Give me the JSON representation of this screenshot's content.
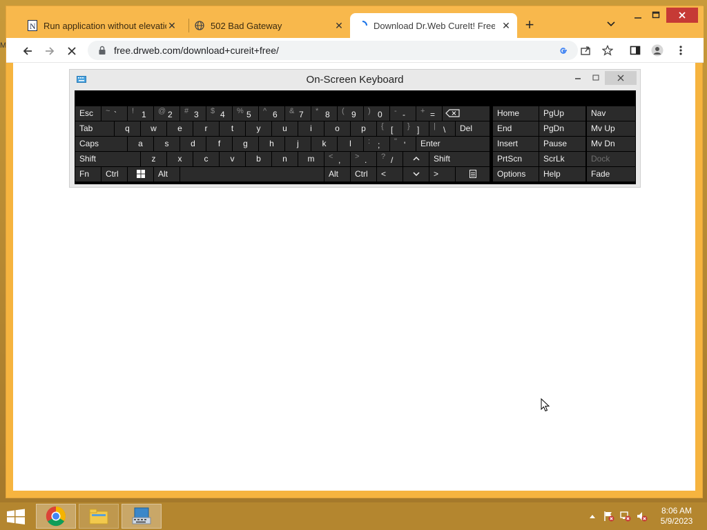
{
  "browser": {
    "tabs": [
      {
        "title": "Run application without elevation",
        "icon": "notion-icon",
        "active": false
      },
      {
        "title": "502 Bad Gateway",
        "icon": "globe-icon",
        "active": false
      },
      {
        "title": "Download Dr.Web CureIt! Free to",
        "icon": "loading-icon",
        "active": true
      }
    ],
    "url": "free.drweb.com/download+cureit+free/"
  },
  "osk": {
    "title": "On-Screen Keyboard",
    "rows": [
      [
        "Esc",
        "~`",
        "!1",
        "@2",
        "#3",
        "$4",
        "%5",
        "^6",
        "&7",
        "*8",
        "(9",
        ")0",
        "-",
        "+=",
        "Home",
        "PgUp",
        "Nav"
      ],
      [
        "Tab",
        "q",
        "w",
        "e",
        "r",
        "t",
        "y",
        "u",
        "i",
        "o",
        "p",
        "[",
        "]",
        "\\",
        "Del",
        "End",
        "PgDn",
        "Mv Up"
      ],
      [
        "Caps",
        "a",
        "s",
        "d",
        "f",
        "g",
        "h",
        "j",
        "k",
        "l",
        ";",
        "'",
        "Enter",
        "Insert",
        "Pause",
        "Mv Dn"
      ],
      [
        "Shift",
        "z",
        "x",
        "c",
        "v",
        "b",
        "n",
        "m",
        ",",
        ".",
        "/",
        "^",
        "Shift",
        "PrtScn",
        "ScrLk",
        "Dock"
      ],
      [
        "Fn",
        "Ctrl",
        "Alt",
        "Alt",
        "Ctrl",
        "<",
        "v",
        ">",
        "Options",
        "Help",
        "Fade"
      ]
    ],
    "keys": {
      "esc": "Esc",
      "tab": "Tab",
      "caps": "Caps",
      "shift": "Shift",
      "fn": "Fn",
      "ctrl": "Ctrl",
      "alt": "Alt",
      "del": "Del",
      "enter": "Enter",
      "home": "Home",
      "pgup": "PgUp",
      "nav": "Nav",
      "end": "End",
      "pgdn": "PgDn",
      "mvup": "Mv Up",
      "insert": "Insert",
      "pause": "Pause",
      "mvdn": "Mv Dn",
      "prtscn": "PrtScn",
      "scrlk": "ScrLk",
      "dock": "Dock",
      "options": "Options",
      "help": "Help",
      "fade": "Fade",
      "lt": "<",
      "gt": ">"
    }
  },
  "taskbar": {
    "time": "8:06 AM",
    "date": "5/9/2023",
    "apps": [
      "chrome-icon",
      "file-explorer-icon",
      "on-screen-keyboard-icon"
    ]
  },
  "desktop": {
    "edge_letter": "M"
  },
  "colors": {
    "accent": "#f8b84c",
    "taskbar": "#b4862f",
    "close": "#c63a35"
  }
}
